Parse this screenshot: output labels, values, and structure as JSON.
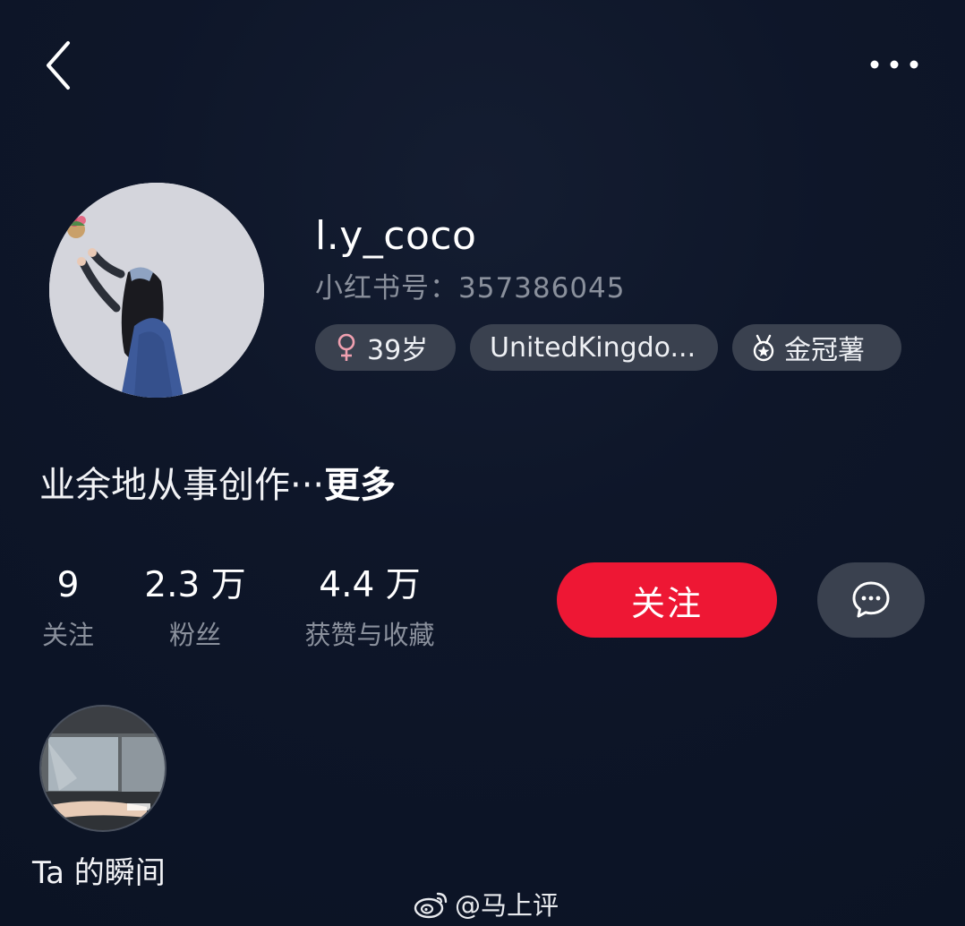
{
  "profile": {
    "username": "l.y_coco",
    "id_line": "小红书号：357386045",
    "tags": {
      "age": "39岁",
      "location": "UnitedKingdo...",
      "badge": "金冠薯"
    },
    "bio_text": "业余地从事创作···",
    "bio_more": "更多"
  },
  "stats": {
    "following": {
      "value": "9",
      "label": "关注"
    },
    "followers": {
      "value": "2.3 万",
      "label": "粉丝"
    },
    "likes": {
      "value": "4.4 万",
      "label": "获赞与收藏"
    }
  },
  "actions": {
    "follow_label": "关注"
  },
  "moments": {
    "label": "Ta 的瞬间"
  },
  "watermark": {
    "text": "@马上评"
  },
  "icons": {
    "back": "chevron-left-icon",
    "more": "more-dots-icon",
    "gender": "female-icon",
    "badge": "medal-icon",
    "message": "chat-bubble-icon",
    "watermark": "weibo-icon"
  },
  "colors": {
    "background": "#0d1526",
    "follow_button": "#ee1734",
    "chip": "#3a414f",
    "muted_text": "#8a909c",
    "female_symbol": "#f0a0b0"
  }
}
